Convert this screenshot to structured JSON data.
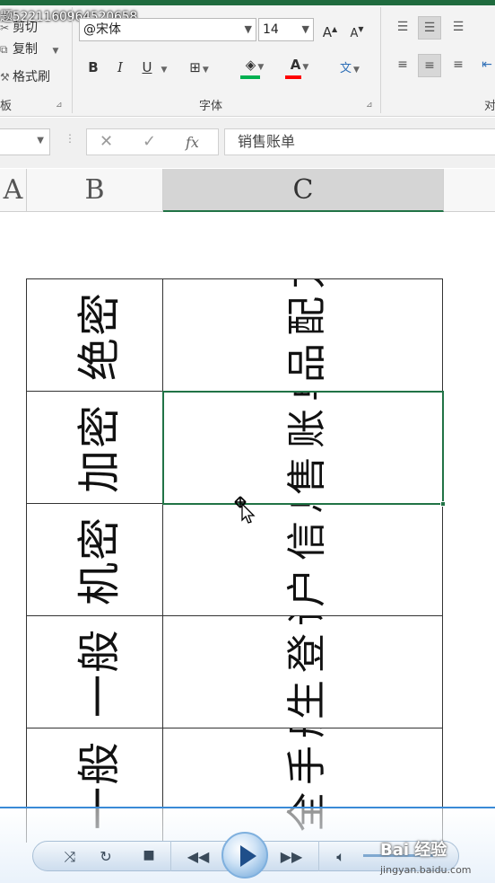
{
  "window": {
    "title": "题5221160964520658"
  },
  "ribbon": {
    "clipboard": {
      "cut_label": "剪切",
      "copy_label": "复制",
      "format_painter_label": "格式刷",
      "group_label": "板"
    },
    "font": {
      "font_name": "@宋体",
      "font_size": "14",
      "increase_size_label": "A",
      "decrease_size_label": "A",
      "bold_label": "B",
      "italic_label": "I",
      "underline_label": "U",
      "font_color_label": "A",
      "phonetic_label": "wén",
      "group_label": "字体",
      "fill_color": "#00b050",
      "font_color": "#ff0000"
    },
    "alignment": {
      "group_label": "对"
    }
  },
  "formula_bar": {
    "cancel_symbol": "✕",
    "enter_symbol": "✓",
    "fx_label": "fx",
    "content": "销售账单"
  },
  "columns": [
    {
      "label": "A"
    },
    {
      "label": "B"
    },
    {
      "label": "C",
      "selected": true
    }
  ],
  "table": {
    "rows": [
      {
        "level": "绝密",
        "item": "产品配方"
      },
      {
        "level": "加密",
        "item": "销售账单"
      },
      {
        "level": "机密",
        "item": "客户信息"
      },
      {
        "level": "一般",
        "item": "卫生登记"
      },
      {
        "level": "一般",
        "item": "安全手册"
      }
    ]
  },
  "selection": {
    "cell_value": "销售账单"
  },
  "player": {
    "watermark": "Bai 经验",
    "watermark_url": "jingyan.baidu.com"
  },
  "colors": {
    "selection": "#217346",
    "player_accent": "#3a8ad6"
  }
}
